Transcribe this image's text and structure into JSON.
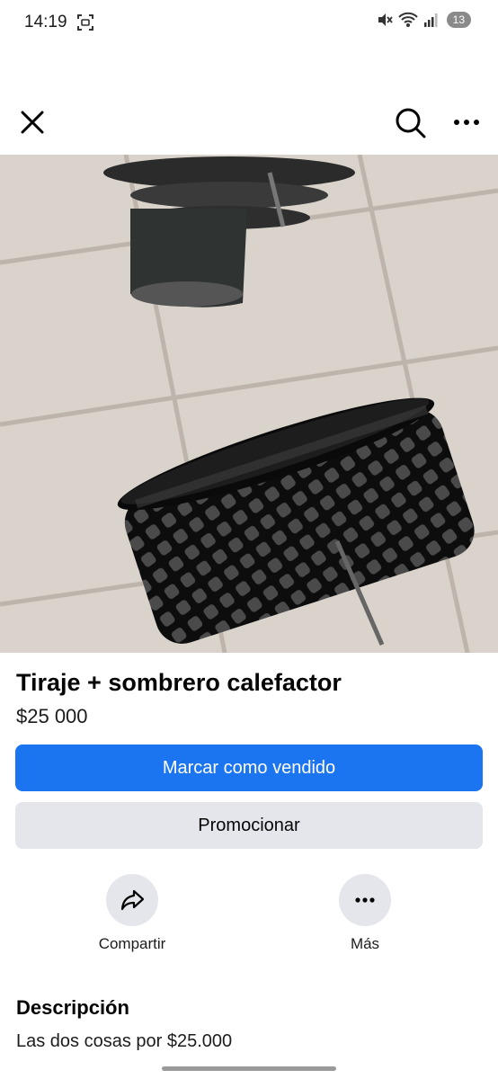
{
  "status_bar": {
    "time": "14:19",
    "battery": "13",
    "icons": [
      "screenshot-icon",
      "mute-icon",
      "wifi-icon",
      "signal-icon",
      "battery-icon"
    ]
  },
  "top_bar": {
    "icons": [
      "close-icon",
      "search-icon",
      "more-icon"
    ]
  },
  "photo": {
    "description_icon": "product-photo",
    "dots_total": 3,
    "dot_active": 1
  },
  "listing": {
    "title": "Tiraje + sombrero calefactor",
    "price": "$25 000"
  },
  "buttons": {
    "mark_sold": "Marcar como vendido",
    "promote": "Promocionar"
  },
  "actions": {
    "share": "Compartir",
    "more": "Más"
  },
  "description": {
    "heading": "Descripción",
    "text": "Las dos cosas por $25.000"
  },
  "colors": {
    "primary": "#1b74f0",
    "secondary": "#e4e6eb",
    "text": "#050505"
  }
}
